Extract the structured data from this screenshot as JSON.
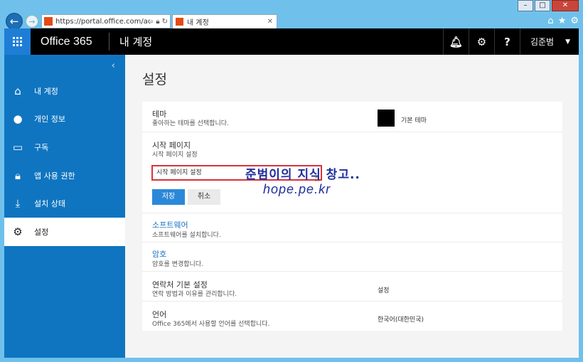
{
  "browser": {
    "back_icon": "back-arrow-icon",
    "forward_icon": "forward-arrow-icon",
    "address": "https://portal.office.com/acc",
    "tab_title": "내 계정",
    "window_buttons": [
      "minimize",
      "maximize",
      "close"
    ],
    "toolbar_icons": [
      "home-icon",
      "star-icon",
      "gear-icon"
    ]
  },
  "header": {
    "brand": "Office 365",
    "app_name": "내 계정",
    "user_name": "김준범"
  },
  "sidebar": {
    "items": [
      {
        "label": "내 계정",
        "icon": "home-icon"
      },
      {
        "label": "개인 정보",
        "icon": "person-icon"
      },
      {
        "label": "구독",
        "icon": "card-icon"
      },
      {
        "label": "앱 사용 권한",
        "icon": "lock-icon"
      },
      {
        "label": "설치 상태",
        "icon": "download-icon"
      },
      {
        "label": "설정",
        "icon": "gear-icon",
        "active": true
      }
    ]
  },
  "main": {
    "title": "설정",
    "theme": {
      "label": "테마",
      "desc": "좋아하는 테마를 선택합니다.",
      "value": "기본 테마",
      "swatch_color": "#000000"
    },
    "start_page": {
      "label": "시작 페이지",
      "desc": "시작 페이지 설정",
      "input_value": "시작 페이지 설정",
      "save": "저장",
      "cancel": "취소"
    },
    "software": {
      "label": "소프트웨어",
      "desc": "소프트웨어를 설치합니다."
    },
    "password": {
      "label": "암호",
      "desc": "암호를 변경합니다."
    },
    "contact": {
      "label": "연락처 기본 설정",
      "desc": "연락 방법과 이유를 관리합니다.",
      "value": "설정"
    },
    "language": {
      "label": "언어",
      "desc": "Office 365에서 사용할 언어를 선택합니다.",
      "value": "한국어(대한민국)"
    }
  },
  "watermark": {
    "line1": "준범이의 지식 창고..",
    "line2": "hope.pe.kr"
  },
  "colors": {
    "accent": "#0f75c0",
    "button_primary": "#2b88d9",
    "link": "#1a73c4",
    "highlight": "#d8323a"
  }
}
